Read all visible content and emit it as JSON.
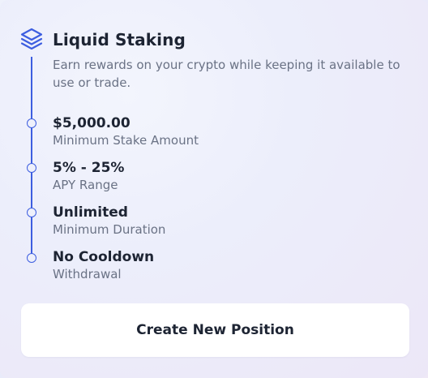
{
  "header": {
    "icon": "layers-icon",
    "title": "Liquid Staking",
    "description": "Earn rewards on your crypto while keeping it available to use or trade."
  },
  "stats": [
    {
      "value": "$5,000.00",
      "label": "Minimum Stake Amount"
    },
    {
      "value": "5% - 25%",
      "label": "APY Range"
    },
    {
      "value": "Unlimited",
      "label": "Minimum Duration"
    },
    {
      "value": "No Cooldown",
      "label": "Withdrawal"
    }
  ],
  "actions": {
    "create_label": "Create New Position"
  },
  "colors": {
    "accent": "#3d5ee0",
    "text_primary": "#1d2433",
    "text_secondary": "#6a7285"
  }
}
